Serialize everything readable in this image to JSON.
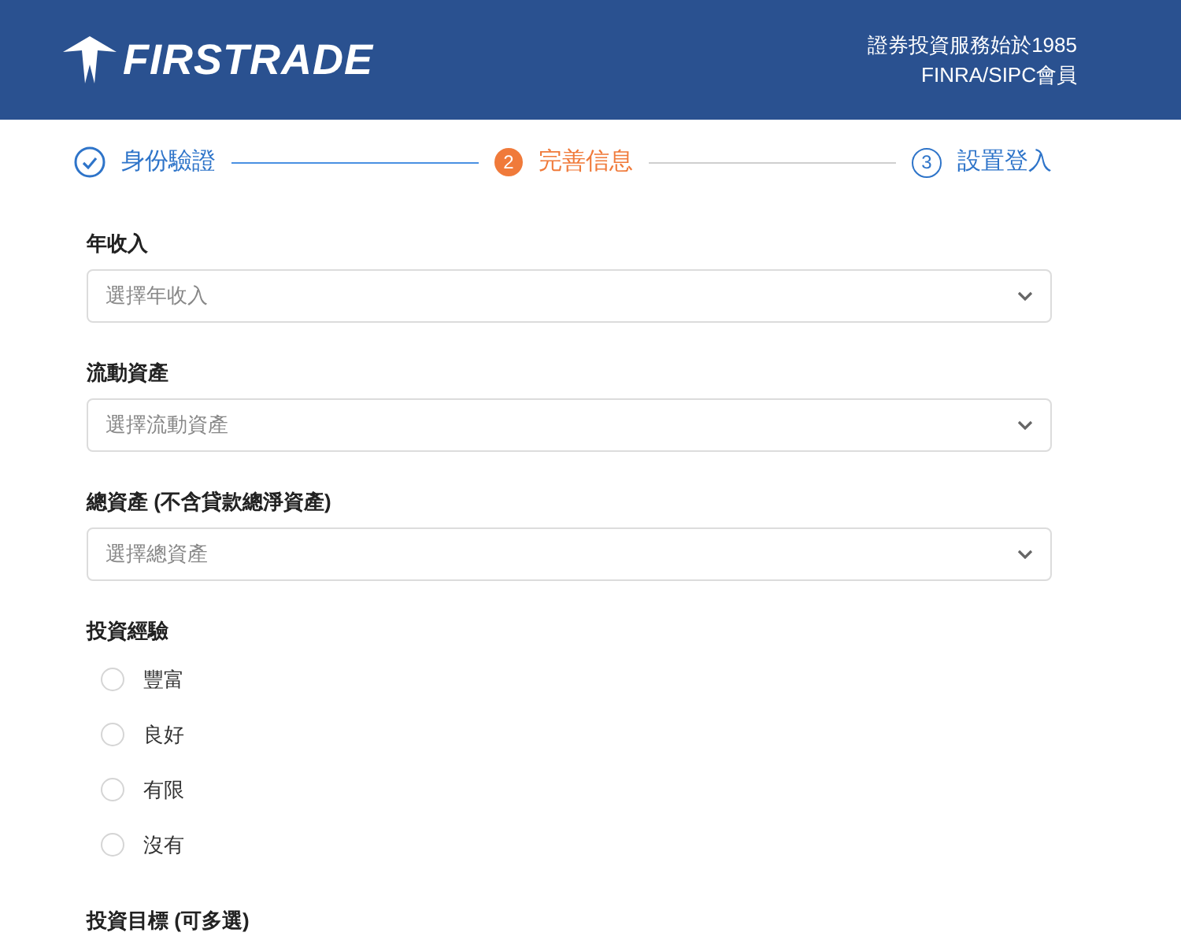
{
  "header": {
    "logo_text": "FIRSTRADE",
    "tagline": "證券投資服務始於1985",
    "membership": "FINRA/SIPC會員"
  },
  "steps": [
    {
      "label": "身份驗證",
      "kind": "done"
    },
    {
      "number": "2",
      "label": "完善信息",
      "kind": "current"
    },
    {
      "number": "3",
      "label": "設置登入",
      "kind": "pending"
    }
  ],
  "fields": [
    {
      "label": "年收入",
      "placeholder": "選擇年收入"
    },
    {
      "label": "流動資產",
      "placeholder": "選擇流動資產"
    },
    {
      "label": "總資產 (不含貸款總淨資產)",
      "placeholder": "選擇總資產"
    }
  ],
  "experience": {
    "label": "投資經驗",
    "options": [
      {
        "label": "豐富",
        "selected": false
      },
      {
        "label": "良好",
        "selected": false
      },
      {
        "label": "有限",
        "selected": false
      },
      {
        "label": "沒有",
        "selected": false
      }
    ]
  },
  "goals": {
    "label": "投資目標 (可多選)"
  }
}
